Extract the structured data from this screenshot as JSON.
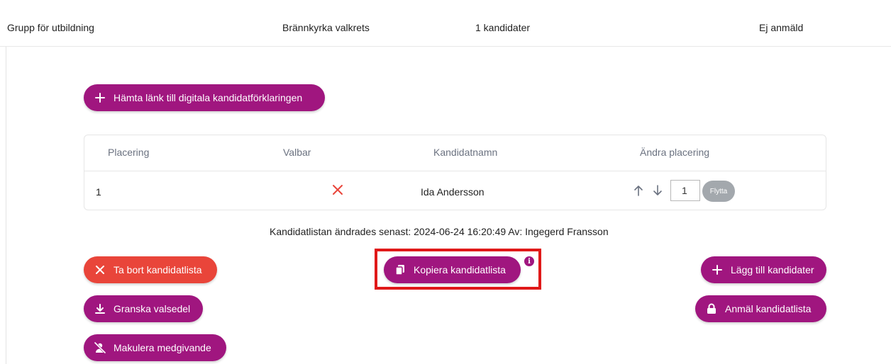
{
  "summary_row": {
    "group": "Grupp för utbildning",
    "district": "Brännkyrka valkrets",
    "count": "1 kandidater",
    "status": "Ej anmäld"
  },
  "link_button": {
    "icon": "plus-icon",
    "label": "Hämta länk till digitala kandidatförklaringen"
  },
  "table": {
    "headers": [
      "Placering",
      "Valbar",
      "Kandidatnamn",
      "Ändra placering"
    ],
    "rows": [
      {
        "placering": "1",
        "valbar_icon": "x-icon",
        "name": "Ida Andersson",
        "position_value": "1",
        "move_label": "Flytta"
      }
    ]
  },
  "last_changed": "Kandidatlistan ändrades senast: 2024-06-24 16:20:49 Av: Ingegerd Fransson",
  "actions": {
    "delete": {
      "label": "Ta bort kandidatlista",
      "icon": "x-icon"
    },
    "ballot": {
      "label": "Granska valsedel",
      "icon": "download-icon"
    },
    "shred": {
      "label": "Makulera medgivande",
      "icon": "user-slash-icon"
    },
    "copy": {
      "label": "Kopiera kandidatlista",
      "icon": "copy-icon",
      "info": "i"
    },
    "add": {
      "label": "Lägg till kandidater",
      "icon": "plus-icon"
    },
    "report": {
      "label": "Anmäl kandidatlista",
      "icon": "lock-icon"
    }
  },
  "colors": {
    "primary": "#a0167f",
    "danger": "#e9453a",
    "highlight": "#e01919",
    "disabled": "#a3a8ad"
  }
}
